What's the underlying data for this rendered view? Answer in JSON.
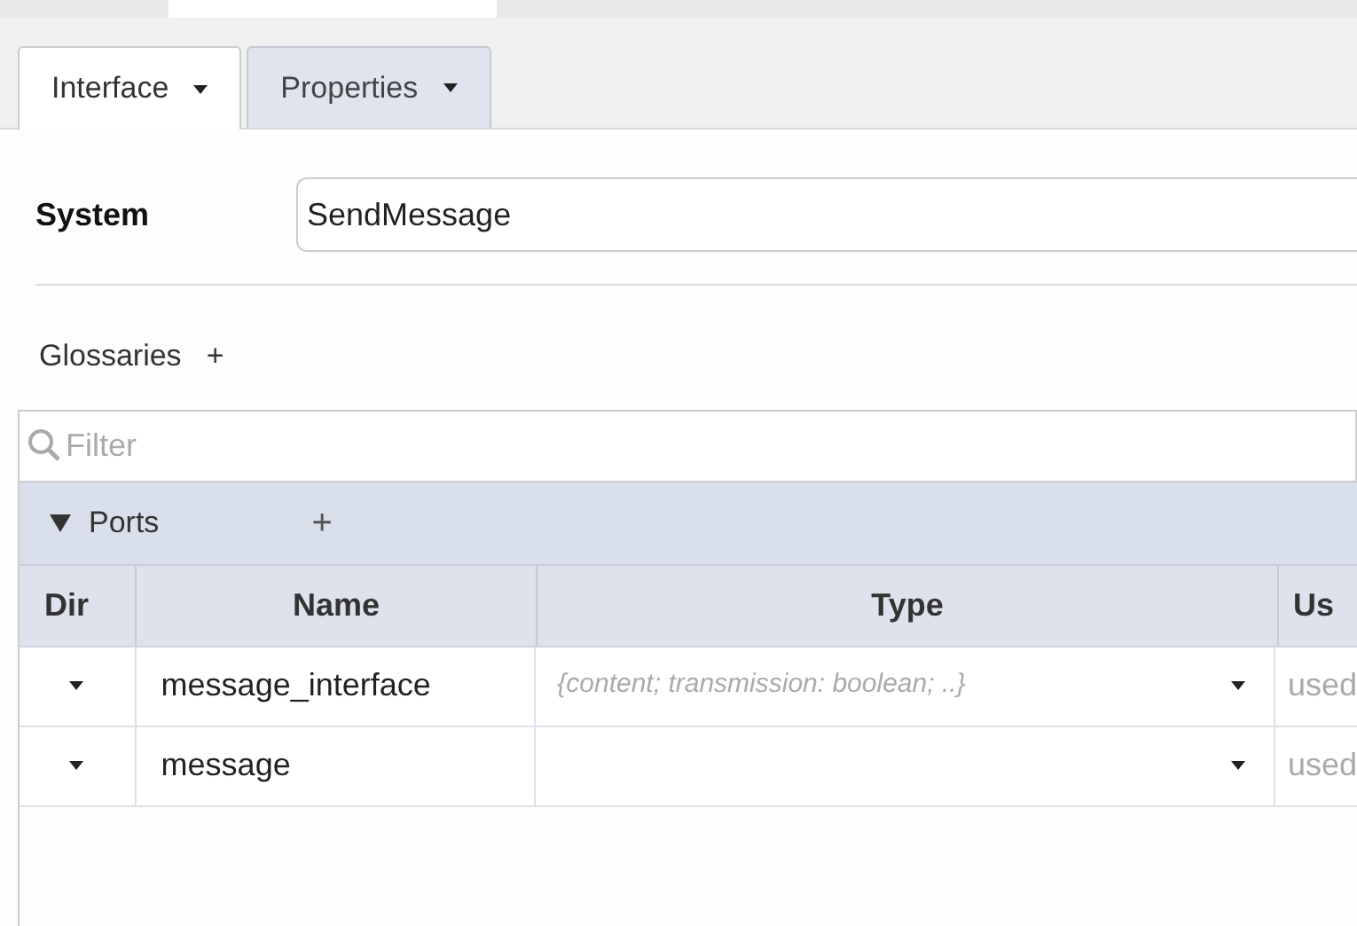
{
  "tabs": [
    {
      "label": "Interface",
      "selected": true
    },
    {
      "label": "Properties",
      "selected": false
    }
  ],
  "system": {
    "label": "System",
    "value": "SendMessage"
  },
  "glossaries": {
    "label": "Glossaries",
    "add": "+"
  },
  "filter": {
    "placeholder": "Filter"
  },
  "ports": {
    "title": "Ports",
    "expanded": true,
    "add": "+",
    "columns": [
      "Dir",
      "Name",
      "Type",
      "Us"
    ],
    "rows": [
      {
        "name": "message_interface",
        "type_placeholder": "{content; transmission: boolean; ..}",
        "usage": "used"
      },
      {
        "name": "message",
        "usage": "used"
      }
    ]
  }
}
